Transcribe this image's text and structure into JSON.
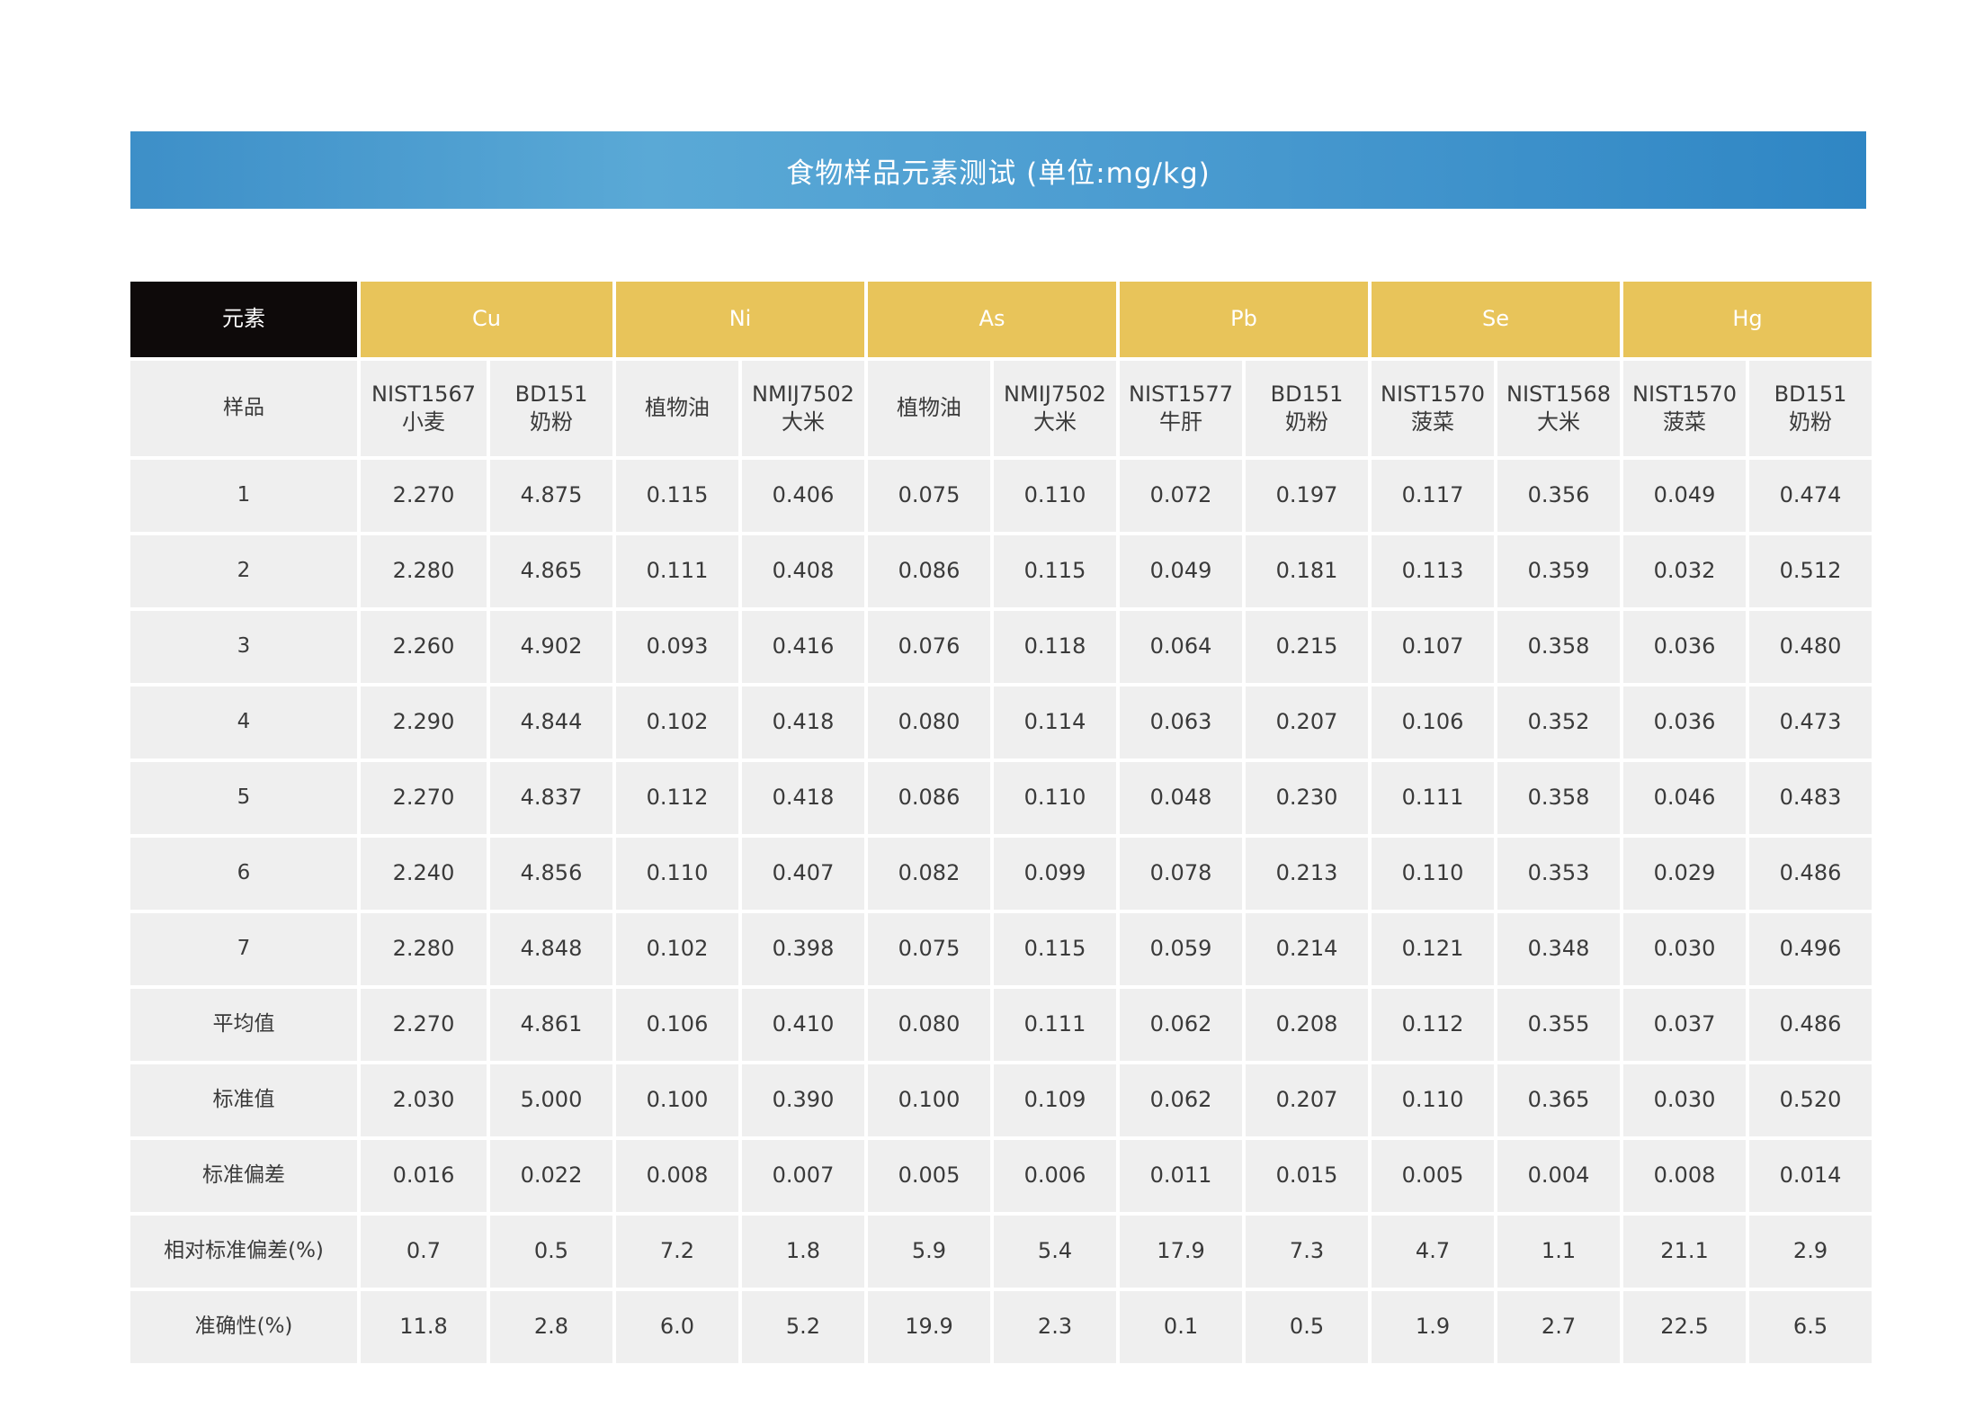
{
  "title": "食物样品元素测试 (单位:mg/kg)",
  "table": {
    "corner_label": "元素",
    "elements": [
      "Cu",
      "Ni",
      "As",
      "Pb",
      "Se",
      "Hg"
    ],
    "sample_label": "样品",
    "samples": [
      {
        "line1": "NIST1567",
        "line2": "小麦"
      },
      {
        "line1": "BD151",
        "line2": "奶粉"
      },
      {
        "line1": "植物油",
        "line2": ""
      },
      {
        "line1": "NMIJ7502",
        "line2": "大米"
      },
      {
        "line1": "植物油",
        "line2": ""
      },
      {
        "line1": "NMIJ7502",
        "line2": "大米"
      },
      {
        "line1": "NIST1577",
        "line2": "牛肝"
      },
      {
        "line1": "BD151",
        "line2": "奶粉"
      },
      {
        "line1": "NIST1570",
        "line2": "菠菜"
      },
      {
        "line1": "NIST1568",
        "line2": "大米"
      },
      {
        "line1": "NIST1570",
        "line2": "菠菜"
      },
      {
        "line1": "BD151",
        "line2": "奶粉"
      }
    ],
    "rows": [
      {
        "label": "1",
        "values": [
          "2.270",
          "4.875",
          "0.115",
          "0.406",
          "0.075",
          "0.110",
          "0.072",
          "0.197",
          "0.117",
          "0.356",
          "0.049",
          "0.474"
        ]
      },
      {
        "label": "2",
        "values": [
          "2.280",
          "4.865",
          "0.111",
          "0.408",
          "0.086",
          "0.115",
          "0.049",
          "0.181",
          "0.113",
          "0.359",
          "0.032",
          "0.512"
        ]
      },
      {
        "label": "3",
        "values": [
          "2.260",
          "4.902",
          "0.093",
          "0.416",
          "0.076",
          "0.118",
          "0.064",
          "0.215",
          "0.107",
          "0.358",
          "0.036",
          "0.480"
        ]
      },
      {
        "label": "4",
        "values": [
          "2.290",
          "4.844",
          "0.102",
          "0.418",
          "0.080",
          "0.114",
          "0.063",
          "0.207",
          "0.106",
          "0.352",
          "0.036",
          "0.473"
        ]
      },
      {
        "label": "5",
        "values": [
          "2.270",
          "4.837",
          "0.112",
          "0.418",
          "0.086",
          "0.110",
          "0.048",
          "0.230",
          "0.111",
          "0.358",
          "0.046",
          "0.483"
        ]
      },
      {
        "label": "6",
        "values": [
          "2.240",
          "4.856",
          "0.110",
          "0.407",
          "0.082",
          "0.099",
          "0.078",
          "0.213",
          "0.110",
          "0.353",
          "0.029",
          "0.486"
        ]
      },
      {
        "label": "7",
        "values": [
          "2.280",
          "4.848",
          "0.102",
          "0.398",
          "0.075",
          "0.115",
          "0.059",
          "0.214",
          "0.121",
          "0.348",
          "0.030",
          "0.496"
        ]
      },
      {
        "label": "平均值",
        "values": [
          "2.270",
          "4.861",
          "0.106",
          "0.410",
          "0.080",
          "0.111",
          "0.062",
          "0.208",
          "0.112",
          "0.355",
          "0.037",
          "0.486"
        ]
      },
      {
        "label": "标准值",
        "values": [
          "2.030",
          "5.000",
          "0.100",
          "0.390",
          "0.100",
          "0.109",
          "0.062",
          "0.207",
          "0.110",
          "0.365",
          "0.030",
          "0.520"
        ]
      },
      {
        "label": "标准偏差",
        "values": [
          "0.016",
          "0.022",
          "0.008",
          "0.007",
          "0.005",
          "0.006",
          "0.011",
          "0.015",
          "0.005",
          "0.004",
          "0.008",
          "0.014"
        ]
      },
      {
        "label": "相对标准偏差(%)",
        "values": [
          "0.7",
          "0.5",
          "7.2",
          "1.8",
          "5.9",
          "5.4",
          "17.9",
          "7.3",
          "4.7",
          "1.1",
          "21.1",
          "2.9"
        ]
      },
      {
        "label": "准确性(%)",
        "values": [
          "11.8",
          "2.8",
          "6.0",
          "5.2",
          "19.9",
          "2.3",
          "0.1",
          "0.5",
          "1.9",
          "2.7",
          "22.5",
          "6.5"
        ]
      }
    ]
  },
  "colors": {
    "title_bar": "#3d8fc8",
    "element_header": "#e8c45a",
    "corner_header": "#0e0a0a",
    "cell_bg": "#efefef"
  }
}
